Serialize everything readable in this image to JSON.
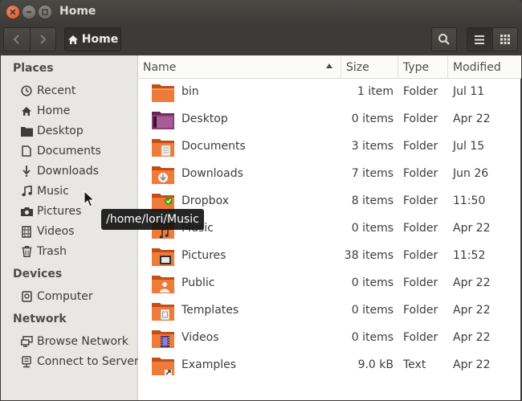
{
  "window": {
    "title": "Home"
  },
  "toolbar": {
    "path_label": "Home",
    "back_icon": "chevron-left-icon",
    "forward_icon": "chevron-right-icon",
    "search_icon": "search-icon",
    "list_view_icon": "list-view-icon",
    "grid_view_icon": "grid-view-icon"
  },
  "sidebar": {
    "places_heading": "Places",
    "places": [
      {
        "label": "Recent",
        "icon": "clock-icon"
      },
      {
        "label": "Home",
        "icon": "home-icon"
      },
      {
        "label": "Desktop",
        "icon": "desktop-folder-icon"
      },
      {
        "label": "Documents",
        "icon": "document-icon"
      },
      {
        "label": "Downloads",
        "icon": "download-icon"
      },
      {
        "label": "Music",
        "icon": "music-icon"
      },
      {
        "label": "Pictures",
        "icon": "camera-icon"
      },
      {
        "label": "Videos",
        "icon": "film-icon"
      },
      {
        "label": "Trash",
        "icon": "trash-icon"
      }
    ],
    "devices_heading": "Devices",
    "devices": [
      {
        "label": "Computer",
        "icon": "drive-icon"
      }
    ],
    "network_heading": "Network",
    "network": [
      {
        "label": "Browse Network",
        "icon": "network-icon"
      },
      {
        "label": "Connect to Server",
        "icon": "server-icon"
      }
    ]
  },
  "columns": {
    "name": "Name",
    "size": "Size",
    "type": "Type",
    "modified": "Modified"
  },
  "files": [
    {
      "name": "bin",
      "size": "1 item",
      "type": "Folder",
      "modified": "Jul 11",
      "icon": "folder-icon"
    },
    {
      "name": "Desktop",
      "size": "0 items",
      "type": "Folder",
      "modified": "Apr 22",
      "icon": "desktop-folder-icon"
    },
    {
      "name": "Documents",
      "size": "3 items",
      "type": "Folder",
      "modified": "Jul 15",
      "icon": "documents-folder-icon"
    },
    {
      "name": "Downloads",
      "size": "7 items",
      "type": "Folder",
      "modified": "Jun 26",
      "icon": "downloads-folder-icon"
    },
    {
      "name": "Dropbox",
      "size": "8 items",
      "type": "Folder",
      "modified": "11:50",
      "icon": "dropbox-folder-icon"
    },
    {
      "name": "Music",
      "size": "0 items",
      "type": "Folder",
      "modified": "Apr 22",
      "icon": "music-folder-icon"
    },
    {
      "name": "Pictures",
      "size": "38 items",
      "type": "Folder",
      "modified": "11:52",
      "icon": "pictures-folder-icon"
    },
    {
      "name": "Public",
      "size": "0 items",
      "type": "Folder",
      "modified": "Apr 22",
      "icon": "public-folder-icon"
    },
    {
      "name": "Templates",
      "size": "0 items",
      "type": "Folder",
      "modified": "Apr 22",
      "icon": "templates-folder-icon"
    },
    {
      "name": "Videos",
      "size": "0 items",
      "type": "Folder",
      "modified": "Apr 22",
      "icon": "videos-folder-icon"
    },
    {
      "name": "Examples",
      "size": "9.0 kB",
      "type": "Text",
      "modified": "Apr 22",
      "icon": "link-folder-icon"
    }
  ],
  "tooltip": {
    "text": "/home/lori/Music"
  },
  "colors": {
    "titlebar": "#3c3b37",
    "sidebar": "#e8e7e4",
    "folder_orange": "#e86a2c",
    "close_button": "#e3501b"
  }
}
